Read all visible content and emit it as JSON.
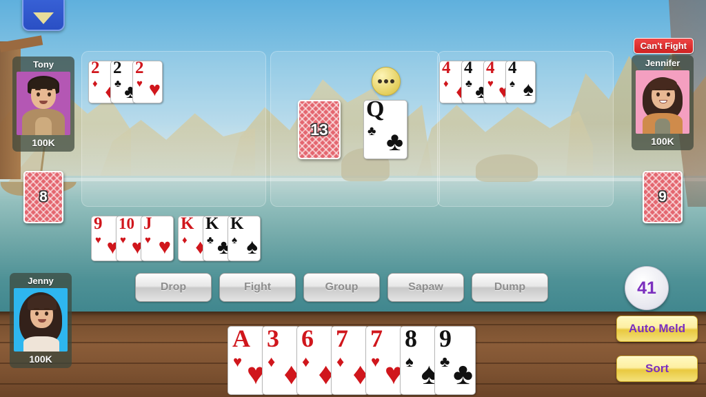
{
  "colors": {
    "accent_purple": "#7b2fbe",
    "yellow_button": "#f3e07a",
    "danger_red": "#cf2222",
    "card_back_red": "#e4666f",
    "blue_button": "#2a4fc4"
  },
  "top_left_button": {
    "name": "menu-expand-button",
    "icon": "chevron-down-icon"
  },
  "players": [
    {
      "key": "tony",
      "name": "Tony",
      "coins": "100K",
      "avatar_bg": "#b457b4"
    },
    {
      "key": "jennifer",
      "name": "Jennifer",
      "coins": "100K",
      "avatar_bg": "#f49fc0",
      "badge": "Can't Fight"
    },
    {
      "key": "jenny",
      "name": "Jenny",
      "coins": "100K",
      "avatar_bg": "#2eb6ef"
    }
  ],
  "decks": {
    "left_count": "8",
    "right_count": "9",
    "stock_count": "13"
  },
  "discard_card": {
    "rank": "Q",
    "suit": "clubs",
    "symbol": "♣",
    "color": "black"
  },
  "thinking_indicator": {
    "dots": 3
  },
  "melds": [
    {
      "panel": "left",
      "rows": [
        {
          "cards": [
            {
              "rank": "2",
              "suit": "diamonds",
              "symbol": "♦",
              "color": "red"
            },
            {
              "rank": "2",
              "suit": "clubs",
              "symbol": "♣",
              "color": "black"
            },
            {
              "rank": "2",
              "suit": "hearts",
              "symbol": "♥",
              "color": "red"
            }
          ]
        }
      ]
    },
    {
      "panel": "middle",
      "rows": []
    },
    {
      "panel": "right",
      "rows": [
        {
          "cards": [
            {
              "rank": "4",
              "suit": "diamonds",
              "symbol": "♦",
              "color": "red"
            },
            {
              "rank": "4",
              "suit": "clubs",
              "symbol": "♣",
              "color": "black"
            },
            {
              "rank": "4",
              "suit": "hearts",
              "symbol": "♥",
              "color": "red"
            },
            {
              "rank": "4",
              "suit": "spades",
              "symbol": "♠",
              "color": "black"
            }
          ]
        }
      ]
    }
  ],
  "player_melds": [
    {
      "name": "hearts-run",
      "cards": [
        {
          "rank": "9",
          "suit": "hearts",
          "symbol": "♥",
          "color": "red"
        },
        {
          "rank": "10",
          "suit": "hearts",
          "symbol": "♥",
          "color": "red"
        },
        {
          "rank": "J",
          "suit": "hearts",
          "symbol": "♥",
          "color": "red"
        }
      ]
    },
    {
      "name": "kings-set",
      "cards": [
        {
          "rank": "K",
          "suit": "diamonds",
          "symbol": "♦",
          "color": "red"
        },
        {
          "rank": "K",
          "suit": "clubs",
          "symbol": "♣",
          "color": "black"
        },
        {
          "rank": "K",
          "suit": "spades",
          "symbol": "♠",
          "color": "black"
        }
      ]
    }
  ],
  "hand": [
    {
      "rank": "A",
      "suit": "hearts",
      "symbol": "♥",
      "color": "red"
    },
    {
      "rank": "3",
      "suit": "diamonds",
      "symbol": "♦",
      "color": "red"
    },
    {
      "rank": "6",
      "suit": "diamonds",
      "symbol": "♦",
      "color": "red"
    },
    {
      "rank": "7",
      "suit": "diamonds",
      "symbol": "♦",
      "color": "red"
    },
    {
      "rank": "7",
      "suit": "hearts",
      "symbol": "♥",
      "color": "red"
    },
    {
      "rank": "8",
      "suit": "spades",
      "symbol": "♠",
      "color": "black"
    },
    {
      "rank": "9",
      "suit": "clubs",
      "symbol": "♣",
      "color": "black"
    }
  ],
  "actions": [
    {
      "key": "drop",
      "label": "Drop"
    },
    {
      "key": "fight",
      "label": "Fight"
    },
    {
      "key": "group",
      "label": "Group"
    },
    {
      "key": "sapaw",
      "label": "Sapaw"
    },
    {
      "key": "dump",
      "label": "Dump"
    }
  ],
  "side_panel": {
    "score": "41",
    "auto_meld_label": "Auto Meld",
    "sort_label": "Sort"
  }
}
